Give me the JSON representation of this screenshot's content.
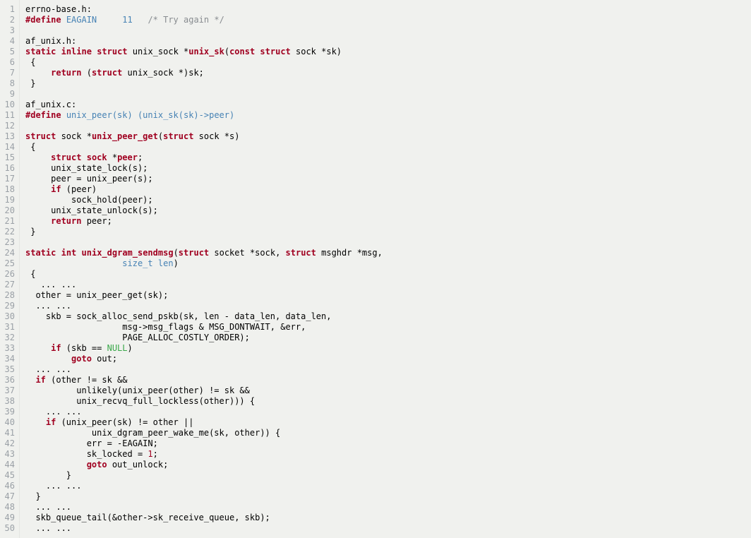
{
  "lines": [
    {
      "n": 1,
      "html": [
        {
          "t": "errno-base.h:"
        }
      ]
    },
    {
      "n": 2,
      "html": [
        {
          "t": "#define",
          "c": "kw-redb"
        },
        {
          "t": " "
        },
        {
          "t": "EAGAIN",
          "c": "kw-dir"
        },
        {
          "t": "     "
        },
        {
          "t": "11",
          "c": "kw-dir"
        },
        {
          "t": "   "
        },
        {
          "t": "/* Try again */",
          "c": "comment"
        }
      ]
    },
    {
      "n": 3,
      "html": [
        {
          "t": ""
        }
      ]
    },
    {
      "n": 4,
      "html": [
        {
          "t": "af_unix.h:"
        }
      ]
    },
    {
      "n": 5,
      "html": [
        {
          "t": "static",
          "c": "kw-redb"
        },
        {
          "t": " "
        },
        {
          "t": "inline",
          "c": "kw-redb"
        },
        {
          "t": " "
        },
        {
          "t": "struct",
          "c": "kw-redb"
        },
        {
          "t": " unix_sock *"
        },
        {
          "t": "unix_sk",
          "c": "kw-redb"
        },
        {
          "t": "("
        },
        {
          "t": "const",
          "c": "kw-redb"
        },
        {
          "t": " "
        },
        {
          "t": "struct",
          "c": "kw-redb"
        },
        {
          "t": " sock *sk)"
        }
      ]
    },
    {
      "n": 6,
      "html": [
        {
          "t": " {"
        }
      ]
    },
    {
      "n": 7,
      "html": [
        {
          "t": "     "
        },
        {
          "t": "return",
          "c": "kw-redb"
        },
        {
          "t": " ("
        },
        {
          "t": "struct",
          "c": "kw-redb"
        },
        {
          "t": " unix_sock *)sk;"
        }
      ]
    },
    {
      "n": 8,
      "html": [
        {
          "t": " }"
        }
      ]
    },
    {
      "n": 9,
      "html": [
        {
          "t": ""
        }
      ]
    },
    {
      "n": 10,
      "html": [
        {
          "t": "af_unix.c:"
        }
      ]
    },
    {
      "n": 11,
      "html": [
        {
          "t": "#define",
          "c": "kw-redb"
        },
        {
          "t": " "
        },
        {
          "t": "unix_peer(sk) (unix_sk(sk)->peer)",
          "c": "kw-dir"
        }
      ]
    },
    {
      "n": 12,
      "html": [
        {
          "t": ""
        }
      ]
    },
    {
      "n": 13,
      "html": [
        {
          "t": "struct",
          "c": "kw-redb"
        },
        {
          "t": " sock *"
        },
        {
          "t": "unix_peer_get",
          "c": "kw-redb"
        },
        {
          "t": "("
        },
        {
          "t": "struct",
          "c": "kw-redb"
        },
        {
          "t": " sock *s)"
        }
      ]
    },
    {
      "n": 14,
      "html": [
        {
          "t": " {"
        }
      ]
    },
    {
      "n": 15,
      "html": [
        {
          "t": "     "
        },
        {
          "t": "struct",
          "c": "kw-redb"
        },
        {
          "t": " "
        },
        {
          "t": "sock",
          "c": "kw-redb"
        },
        {
          "t": " *"
        },
        {
          "t": "peer",
          "c": "kw-redb"
        },
        {
          "t": ";"
        }
      ]
    },
    {
      "n": 16,
      "html": [
        {
          "t": "     unix_state_lock(s);"
        }
      ]
    },
    {
      "n": 17,
      "html": [
        {
          "t": "     peer = unix_peer(s);"
        }
      ]
    },
    {
      "n": 18,
      "html": [
        {
          "t": "     "
        },
        {
          "t": "if",
          "c": "kw-redb"
        },
        {
          "t": " (peer)"
        }
      ]
    },
    {
      "n": 19,
      "html": [
        {
          "t": "         sock_hold(peer);"
        }
      ]
    },
    {
      "n": 20,
      "html": [
        {
          "t": "     unix_state_unlock(s);"
        }
      ]
    },
    {
      "n": 21,
      "html": [
        {
          "t": "     "
        },
        {
          "t": "return",
          "c": "kw-redb"
        },
        {
          "t": " peer;"
        }
      ]
    },
    {
      "n": 22,
      "html": [
        {
          "t": " }"
        }
      ]
    },
    {
      "n": 23,
      "html": [
        {
          "t": ""
        }
      ]
    },
    {
      "n": 24,
      "html": [
        {
          "t": "static",
          "c": "kw-redb"
        },
        {
          "t": " "
        },
        {
          "t": "int",
          "c": "kw-redb"
        },
        {
          "t": " "
        },
        {
          "t": "unix_dgram_sendmsg",
          "c": "kw-redb"
        },
        {
          "t": "("
        },
        {
          "t": "struct",
          "c": "kw-redb"
        },
        {
          "t": " socket *sock, "
        },
        {
          "t": "struct",
          "c": "kw-redb"
        },
        {
          "t": " msghdr *msg,"
        }
      ]
    },
    {
      "n": 25,
      "html": [
        {
          "t": "                   "
        },
        {
          "t": "size_t",
          "c": "kw-dir"
        },
        {
          "t": " "
        },
        {
          "t": "len",
          "c": "kw-dir"
        },
        {
          "t": ")"
        }
      ]
    },
    {
      "n": 26,
      "html": [
        {
          "t": " {"
        }
      ]
    },
    {
      "n": 27,
      "html": [
        {
          "t": "   ... ..."
        }
      ]
    },
    {
      "n": 28,
      "html": [
        {
          "t": "  other = unix_peer_get(sk);"
        }
      ]
    },
    {
      "n": 29,
      "html": [
        {
          "t": "  ... ..."
        }
      ]
    },
    {
      "n": 30,
      "html": [
        {
          "t": "    skb = sock_alloc_send_pskb(sk, len - data_len, data_len,"
        }
      ]
    },
    {
      "n": 31,
      "html": [
        {
          "t": "                   msg->msg_flags & MSG_DONTWAIT, &err,"
        }
      ]
    },
    {
      "n": 32,
      "html": [
        {
          "t": "                   PAGE_ALLOC_COSTLY_ORDER);"
        }
      ]
    },
    {
      "n": 33,
      "html": [
        {
          "t": "     "
        },
        {
          "t": "if",
          "c": "kw-redb"
        },
        {
          "t": " (skb == "
        },
        {
          "t": "NULL",
          "c": "null"
        },
        {
          "t": ")"
        }
      ]
    },
    {
      "n": 34,
      "html": [
        {
          "t": "         "
        },
        {
          "t": "goto",
          "c": "kw-redb"
        },
        {
          "t": " out;"
        }
      ]
    },
    {
      "n": 35,
      "html": [
        {
          "t": "  ... ..."
        }
      ]
    },
    {
      "n": 36,
      "html": [
        {
          "t": "  "
        },
        {
          "t": "if",
          "c": "kw-redb"
        },
        {
          "t": " (other != sk &&"
        }
      ]
    },
    {
      "n": 37,
      "html": [
        {
          "t": "          unlikely(unix_peer(other) != sk &&"
        }
      ]
    },
    {
      "n": 38,
      "html": [
        {
          "t": "          unix_recvq_full_lockless(other))) {"
        }
      ]
    },
    {
      "n": 39,
      "html": [
        {
          "t": "    ... ..."
        }
      ]
    },
    {
      "n": 40,
      "html": [
        {
          "t": "    "
        },
        {
          "t": "if",
          "c": "kw-redb"
        },
        {
          "t": " (unix_peer(sk) != other ||"
        }
      ]
    },
    {
      "n": 41,
      "html": [
        {
          "t": "             unix_dgram_peer_wake_me(sk, other)) {"
        }
      ]
    },
    {
      "n": 42,
      "html": [
        {
          "t": "            err = -EAGAIN;"
        }
      ]
    },
    {
      "n": 43,
      "html": [
        {
          "t": "            sk_locked = "
        },
        {
          "t": "1",
          "c": "kw-red"
        },
        {
          "t": ";"
        }
      ]
    },
    {
      "n": 44,
      "html": [
        {
          "t": "            "
        },
        {
          "t": "goto",
          "c": "kw-redb"
        },
        {
          "t": " out_unlock;"
        }
      ]
    },
    {
      "n": 45,
      "html": [
        {
          "t": "        }"
        }
      ]
    },
    {
      "n": 46,
      "html": [
        {
          "t": "    ... ..."
        }
      ]
    },
    {
      "n": 47,
      "html": [
        {
          "t": "  }"
        }
      ]
    },
    {
      "n": 48,
      "html": [
        {
          "t": "  ... ..."
        }
      ]
    },
    {
      "n": 49,
      "html": [
        {
          "t": "  skb_queue_tail(&other->sk_receive_queue, skb);"
        }
      ]
    },
    {
      "n": 50,
      "html": [
        {
          "t": "  ... ..."
        }
      ]
    }
  ]
}
